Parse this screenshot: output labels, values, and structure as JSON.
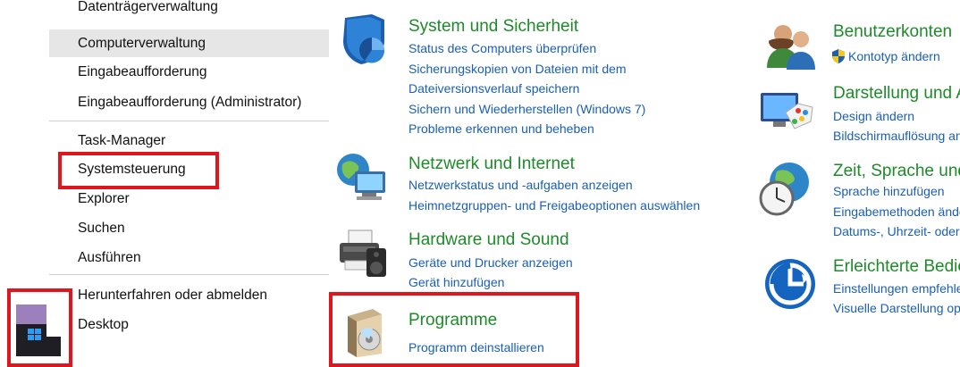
{
  "menu": {
    "items": [
      {
        "label": "Datenträgerverwaltung"
      },
      {
        "label": "Computerverwaltung"
      },
      {
        "label": "Eingabeaufforderung"
      },
      {
        "label": "Eingabeaufforderung (Administrator)"
      },
      {
        "label": "Task-Manager"
      },
      {
        "label": "Systemsteuerung"
      },
      {
        "label": "Explorer"
      },
      {
        "label": "Suchen"
      },
      {
        "label": "Ausführen"
      },
      {
        "label": "Herunterfahren oder abmelden"
      },
      {
        "label": "Desktop"
      }
    ]
  },
  "start": {
    "icon": "windows-logo-icon"
  },
  "control_panel": {
    "left": [
      {
        "title": "System und Sicherheit",
        "icon": "shield-icon",
        "links": [
          "Status des Computers überprüfen",
          "Sicherungskopien von Dateien mit dem",
          "Dateiversionsverlauf speichern",
          "Sichern und Wiederherstellen (Windows 7)",
          "Probleme erkennen und beheben"
        ]
      },
      {
        "title": "Netzwerk und Internet",
        "icon": "network-globe-icon",
        "links": [
          "Netzwerkstatus und -aufgaben anzeigen",
          "Heimnetzgruppen- und Freigabeoptionen auswählen"
        ]
      },
      {
        "title": "Hardware und Sound",
        "icon": "printer-speaker-icon",
        "links": [
          "Geräte und Drucker anzeigen",
          "Gerät hinzufügen"
        ]
      },
      {
        "title": "Programme",
        "icon": "programs-disc-icon",
        "links": [
          "Programm deinstallieren"
        ]
      }
    ],
    "right": [
      {
        "title": "Benutzerkonten",
        "icon": "users-icon",
        "links": [
          "Kontotyp ändern"
        ]
      },
      {
        "title": "Darstellung und Anpassung",
        "icon": "display-palette-icon",
        "links": [
          "Design ändern",
          "Bildschirmauflösung anpassen"
        ]
      },
      {
        "title": "Zeit, Sprache und Region",
        "icon": "clock-globe-icon",
        "links": [
          "Sprache hinzufügen",
          "Eingabemethoden ändern",
          "Datums-, Uhrzeit- oder Zahlenformate ändern"
        ]
      },
      {
        "title": "Erleichterte Bedienung",
        "icon": "ease-of-access-icon",
        "links": [
          "Einstellungen empfehlen lassen",
          "Visuelle Darstellung optimieren"
        ]
      }
    ]
  },
  "colors": {
    "highlight_box": "#e0161e",
    "category_title": "#1e8a2a",
    "link": "#1a5fb4"
  }
}
